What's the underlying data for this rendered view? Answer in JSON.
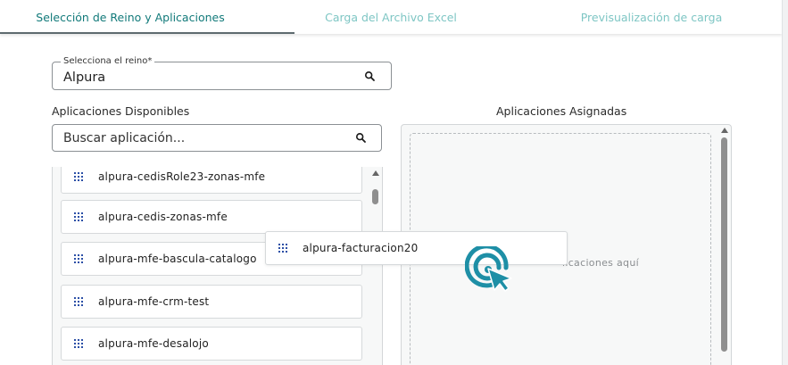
{
  "tabs": [
    {
      "label": "Selección de Reino y Aplicaciones",
      "active": true
    },
    {
      "label": "Carga del Archivo Excel",
      "active": false
    },
    {
      "label": "Previsualización de carga",
      "active": false
    }
  ],
  "reino": {
    "label": "Selecciona el reino*",
    "value": "Alpura"
  },
  "available": {
    "title": "Aplicaciones Disponibles",
    "search_placeholder": "Buscar aplicación...",
    "items": [
      "alpura-cedisRole23-zonas-mfe",
      "alpura-cedis-zonas-mfe",
      "alpura-mfe-bascula-catalogo",
      "alpura-mfe-crm-test",
      "alpura-mfe-desalojo"
    ]
  },
  "assigned": {
    "title": "Aplicaciones Asignadas",
    "drop_hint": "licaciones aquí"
  },
  "drag_item": {
    "label": "alpura-facturacion20"
  },
  "colors": {
    "tab_active": "#127a7a",
    "tab_inactive": "#7ec6c4",
    "cursor": "#1e8fa6",
    "grip": "#2b4fa6"
  },
  "icons": {
    "reino_search": "search-icon",
    "buscar_search": "search-icon",
    "item_grip": "drag-handle-icon",
    "cursor": "click-cursor-icon"
  }
}
